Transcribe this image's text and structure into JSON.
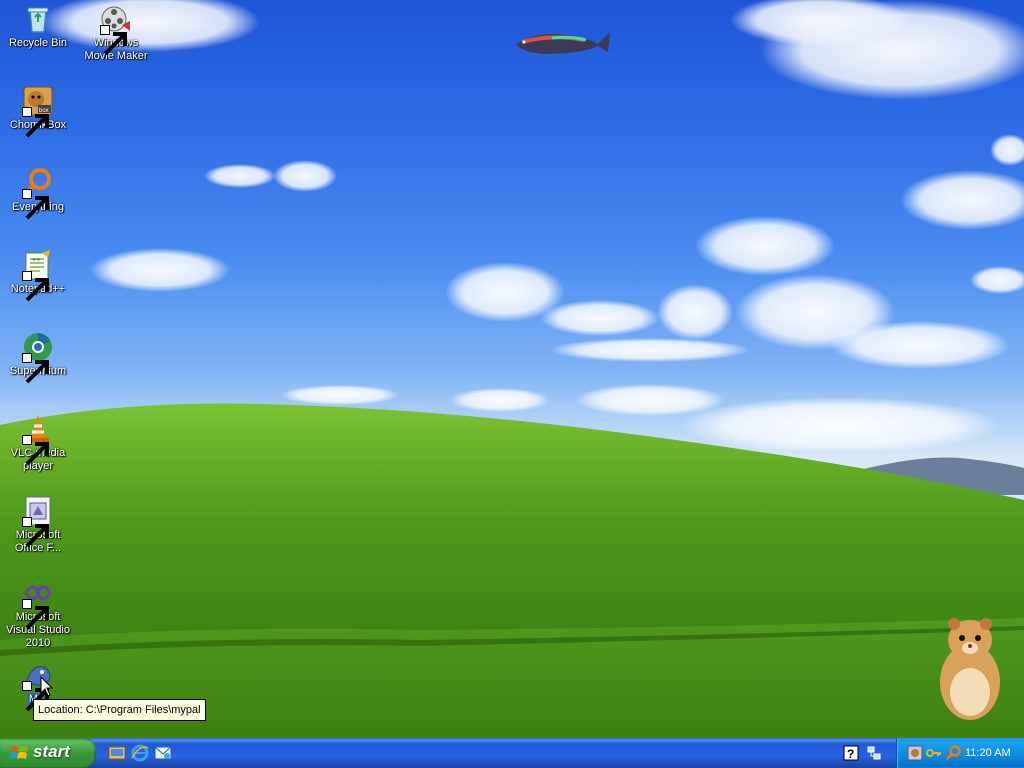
{
  "desktop": {
    "icons": [
      {
        "label": "Recycle Bin",
        "icon": "recycle-bin-icon"
      },
      {
        "label": "Windows Movie Maker",
        "icon": "movie-maker-icon"
      },
      {
        "label": "ChomikBox",
        "icon": "chomikbox-icon"
      },
      {
        "label": "Everything",
        "icon": "everything-search-icon"
      },
      {
        "label": "Notepad++",
        "icon": "notepad-plus-plus-icon"
      },
      {
        "label": "Supermium",
        "icon": "supermium-browser-icon"
      },
      {
        "label": "VLC media player",
        "icon": "vlc-cone-icon"
      },
      {
        "label": "Microsoft Office F...",
        "icon": "office-document-icon"
      },
      {
        "label": "Microsoft Visual Studio 2010",
        "icon": "visual-studio-icon"
      },
      {
        "label": "M...",
        "icon": "mypal-icon"
      }
    ],
    "tooltip": "Location: C:\\Program Files\\mypal"
  },
  "taskbar": {
    "start_label": "start",
    "quick_launch": [
      "show-desktop-icon",
      "internet-explorer-icon",
      "outlook-express-icon"
    ],
    "notify_icons": [
      "help-icon",
      "network-icon"
    ],
    "tray_icons": [
      "chomikbox-tray-icon",
      "key-icon",
      "search-tray-icon"
    ],
    "clock": "11:20 AM"
  },
  "colors": {
    "taskbar_blue": "#2663e0",
    "start_green": "#3a9a3a",
    "tray_blue": "#0c8ae0",
    "tooltip_bg": "#ffffe1"
  }
}
